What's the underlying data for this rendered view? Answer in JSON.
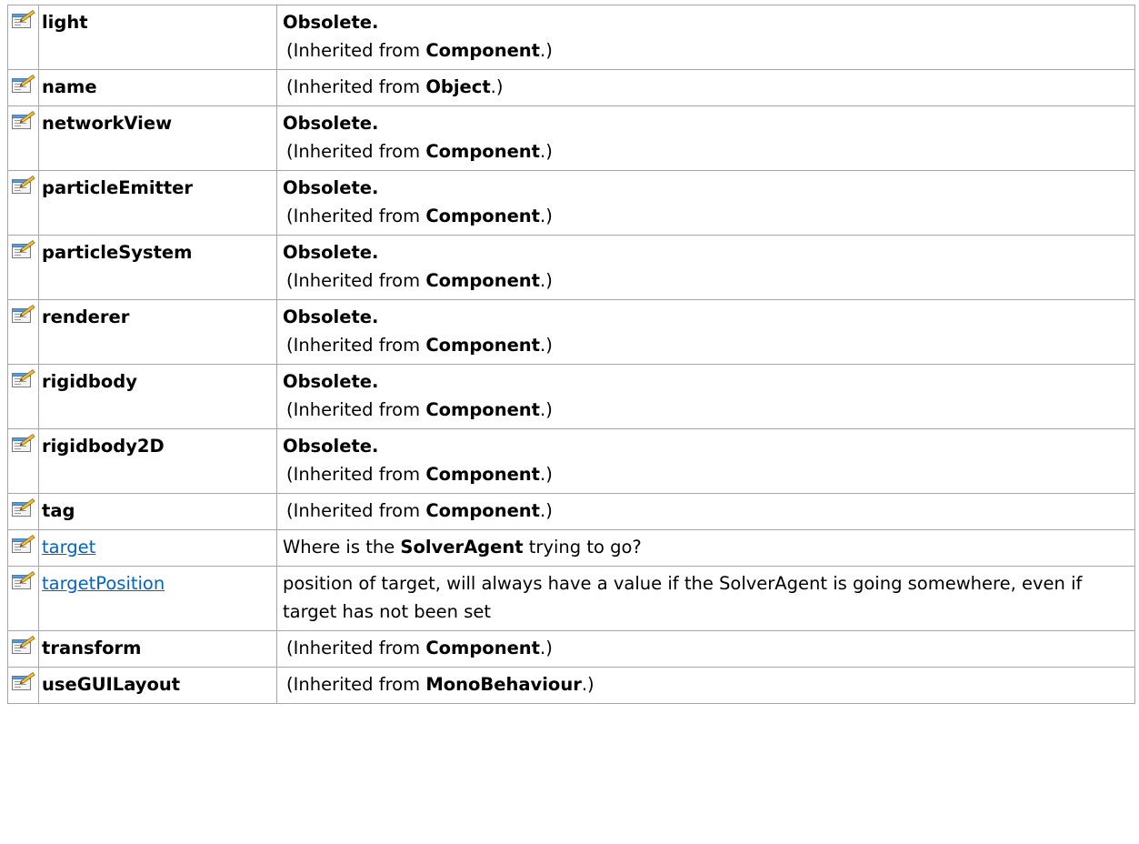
{
  "rows": [
    {
      "name": "light",
      "link": false,
      "obsolete": "Obsolete.",
      "pre": "(Inherited from ",
      "bold": "Component",
      "post": ".)"
    },
    {
      "name": "name",
      "link": false,
      "obsolete": "",
      "pre": "(Inherited from ",
      "bold": "Object",
      "post": ".)"
    },
    {
      "name": "networkView",
      "link": false,
      "obsolete": "Obsolete.",
      "pre": "(Inherited from ",
      "bold": "Component",
      "post": ".)"
    },
    {
      "name": "particleEmitter",
      "link": false,
      "obsolete": "Obsolete.",
      "pre": "(Inherited from ",
      "bold": "Component",
      "post": ".)"
    },
    {
      "name": "particleSystem",
      "link": false,
      "obsolete": "Obsolete.",
      "pre": "(Inherited from ",
      "bold": "Component",
      "post": ".)"
    },
    {
      "name": "renderer",
      "link": false,
      "obsolete": "Obsolete.",
      "pre": "(Inherited from ",
      "bold": "Component",
      "post": ".)"
    },
    {
      "name": "rigidbody",
      "link": false,
      "obsolete": "Obsolete.",
      "pre": "(Inherited from ",
      "bold": "Component",
      "post": ".)"
    },
    {
      "name": "rigidbody2D",
      "link": false,
      "obsolete": "Obsolete.",
      "pre": "(Inherited from ",
      "bold": "Component",
      "post": ".)"
    },
    {
      "name": "tag",
      "link": false,
      "obsolete": "",
      "pre": "(Inherited from ",
      "bold": "Component",
      "post": ".)"
    },
    {
      "name": "target",
      "link": true,
      "obsolete": "",
      "pre": "Where is the ",
      "bold": "SolverAgent",
      "post": " trying to go?"
    },
    {
      "name": "targetPosition",
      "link": true,
      "obsolete": "",
      "pre": "position of target, will always have a value if the SolverAgent is going somewhere, even if target has not been set",
      "bold": "",
      "post": ""
    },
    {
      "name": "transform",
      "link": false,
      "obsolete": "",
      "pre": "(Inherited from ",
      "bold": "Component",
      "post": ".)"
    },
    {
      "name": "useGUILayout",
      "link": false,
      "obsolete": "",
      "pre": "(Inherited from ",
      "bold": "MonoBehaviour",
      "post": ".)"
    }
  ],
  "icon": "property-icon",
  "colors": {
    "border": "#a6a6a6",
    "link": "#0563c1"
  }
}
